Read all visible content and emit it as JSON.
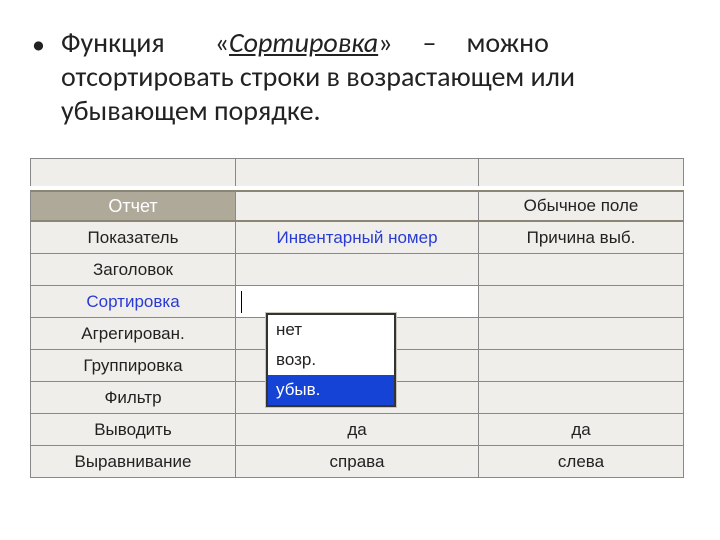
{
  "bullet": {
    "func": "Функция",
    "quote_open": "«",
    "sort": "Сортировка",
    "quote_close": "»",
    "dash": "–",
    "rest1": "можно",
    "line2": "отсортировать строки в возрастающем или",
    "line3": "убывающем порядке."
  },
  "table": {
    "header": {
      "a": "Отчет",
      "c": "Обычное поле"
    },
    "rows": [
      {
        "label": "Показатель",
        "b": "Инвентарный номер",
        "c": "Причина выб."
      },
      {
        "label": "Заголовок",
        "b": "",
        "c": ""
      },
      {
        "label": "Сортировка",
        "b": "",
        "c": "",
        "is_sort_row": true
      },
      {
        "label": "Агрегирован.",
        "b": "",
        "c": ""
      },
      {
        "label": "Группировка",
        "b": "",
        "c": ""
      },
      {
        "label": "Фильтр",
        "b": "",
        "c": ""
      },
      {
        "label": "Выводить",
        "b": "да",
        "c": "да"
      },
      {
        "label": "Выравнивание",
        "b": "справа",
        "c": "слева"
      }
    ],
    "sort_label_blue": "Сортировка",
    "dropdown": {
      "options": [
        "нет",
        "возр.",
        "убыв."
      ],
      "selected_index": 2
    }
  }
}
